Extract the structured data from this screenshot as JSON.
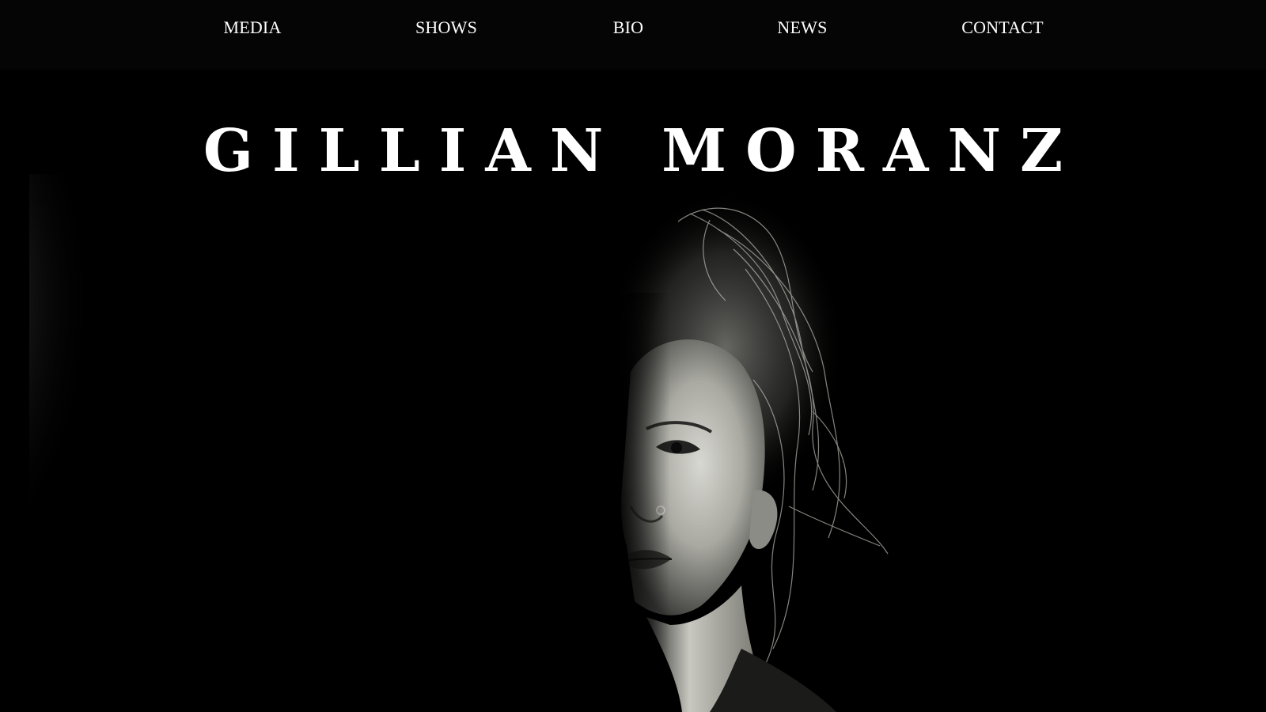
{
  "nav": {
    "items": [
      {
        "label": "MEDIA"
      },
      {
        "label": "SHOWS"
      },
      {
        "label": "BIO"
      },
      {
        "label": "NEWS"
      },
      {
        "label": "CONTACT"
      }
    ]
  },
  "header": {
    "title": "GILLIAN MORANZ"
  },
  "hero": {
    "image_subject": "black-and-white portrait photograph"
  },
  "colors": {
    "background": "#000000",
    "nav_background": "#050505",
    "text": "#ffffff"
  }
}
